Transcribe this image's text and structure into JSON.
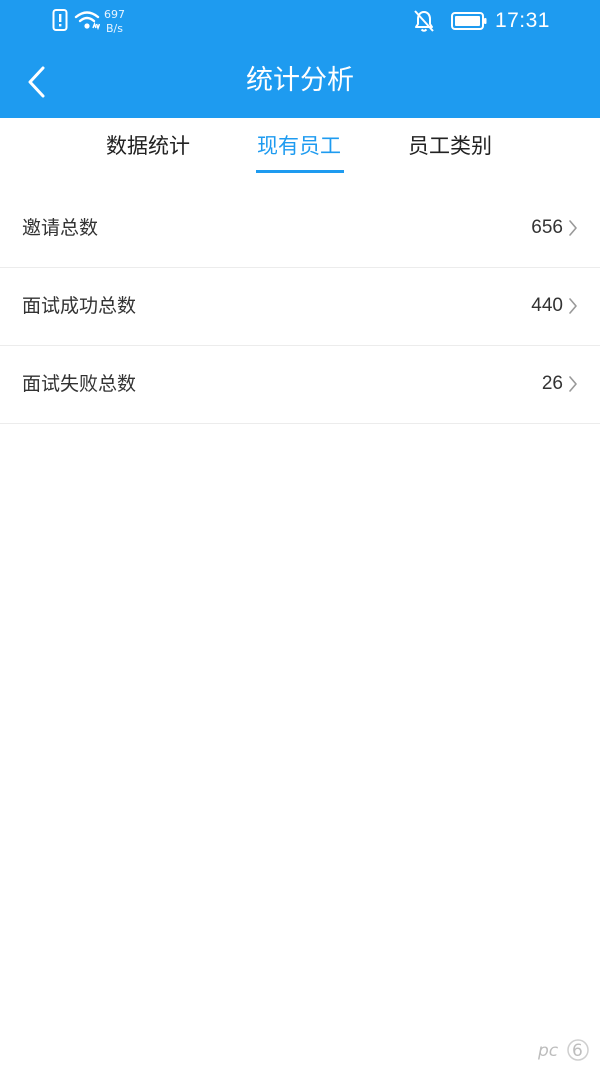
{
  "status_bar": {
    "net_speed_value": "697",
    "net_speed_unit": "B/s",
    "time": "17:31",
    "icons": [
      "alert-icon",
      "wifi-icon",
      "bell-off-icon",
      "battery-icon"
    ]
  },
  "header": {
    "title": "统计分析",
    "back_icon": "chevron-left-icon"
  },
  "tabs": [
    {
      "label": "数据统计",
      "active": false
    },
    {
      "label": "现有员工",
      "active": true
    },
    {
      "label": "员工类别",
      "active": false
    }
  ],
  "rows": [
    {
      "label": "邀请总数",
      "value": "656"
    },
    {
      "label": "面试成功总数",
      "value": "440"
    },
    {
      "label": "面试失败总数",
      "value": "26"
    }
  ],
  "watermark": "pc6",
  "colors": {
    "accent": "#1e9bf0",
    "text": "#333333",
    "divider": "#ececec"
  }
}
